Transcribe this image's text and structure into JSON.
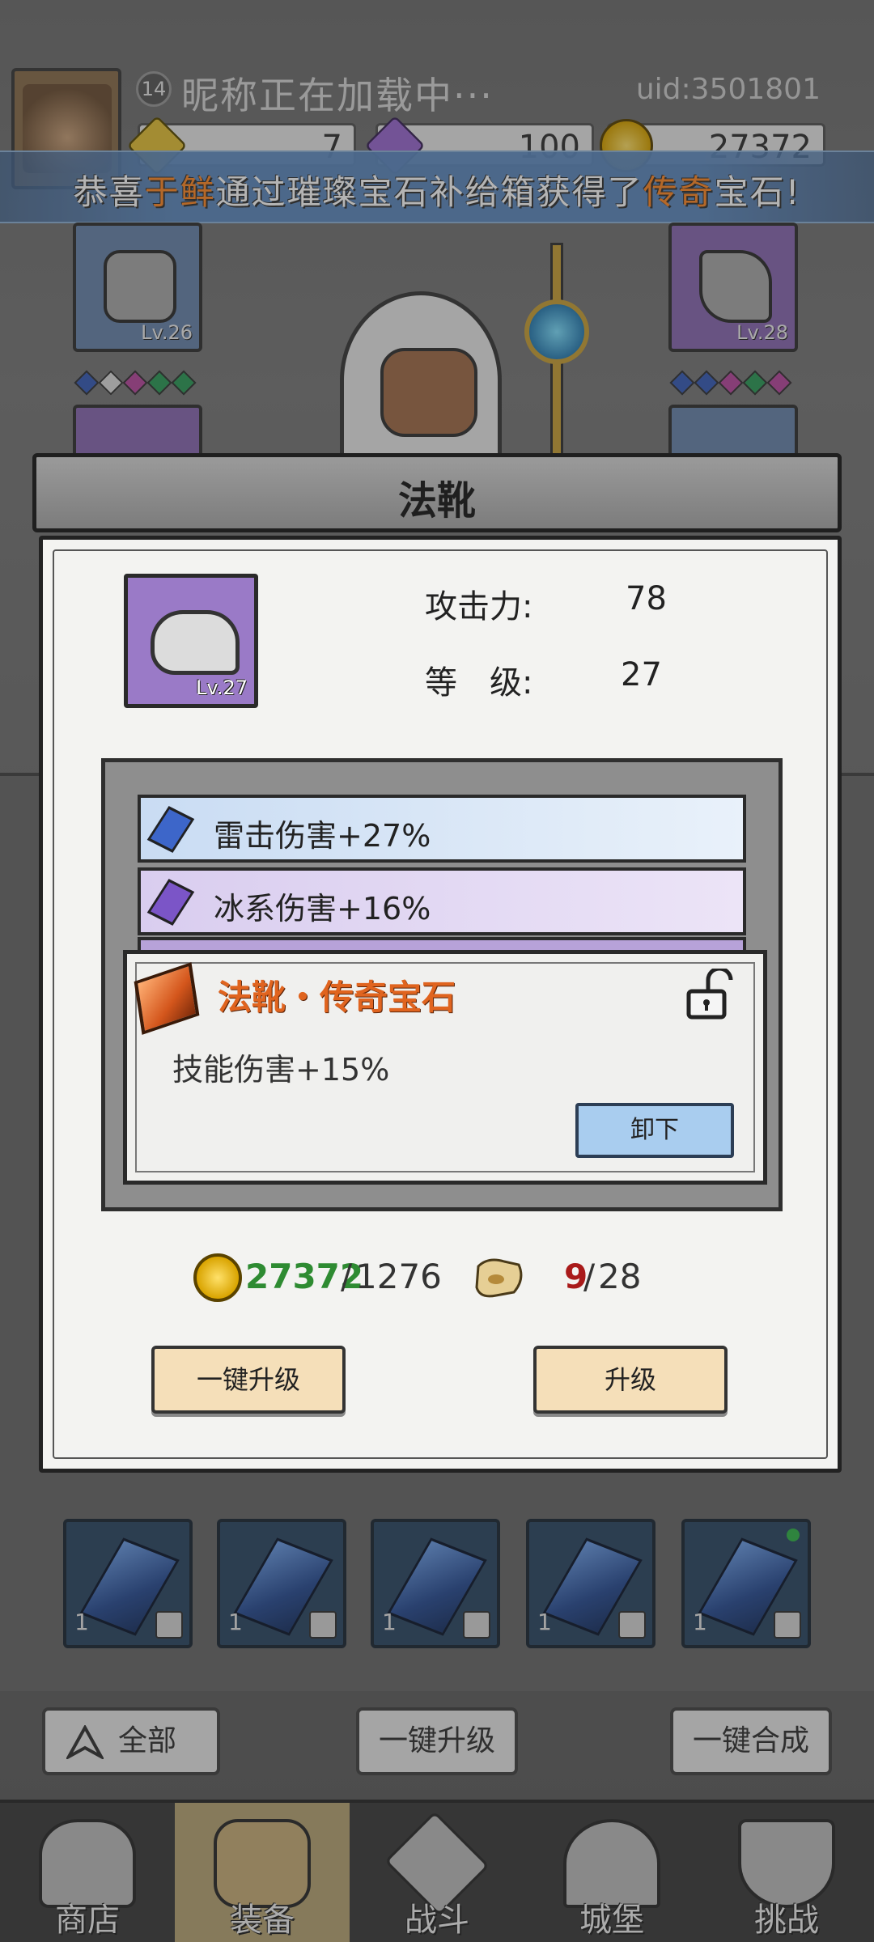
{
  "header": {
    "level": "14",
    "nickname": "昵称正在加载中···",
    "uid": "uid:3501801",
    "currencies": [
      {
        "name": "gold-gem-icon",
        "value": "7",
        "color": "#e5c23a"
      },
      {
        "name": "purple-diamond-icon",
        "value": "100",
        "color": "#9b6ad1"
      },
      {
        "name": "gold-coin-icon",
        "value": "27372",
        "color": "#d9a400"
      }
    ]
  },
  "announcement": {
    "prefix": "恭喜",
    "player": "于鲜",
    "middle": "通过璀璨宝石补给箱获得了",
    "item": "传奇",
    "suffix": "宝石!"
  },
  "equipment_slots": [
    {
      "name": "helmet",
      "level": "Lv.26"
    },
    {
      "name": "pipe",
      "level": "Lv.28"
    }
  ],
  "modal": {
    "title": "法靴",
    "item_level": "Lv.27",
    "stats": [
      {
        "label": "攻击力:",
        "value": "78"
      },
      {
        "label": "等　级:",
        "value": "27"
      }
    ],
    "gems": [
      {
        "text": "雷击伤害+27%",
        "color": "#3d66c9",
        "bg": "#dbe9f7"
      },
      {
        "text": "冰系伤害+16%",
        "color": "#7b55c7",
        "bg": "#e6dcf5"
      }
    ],
    "legend_gem": {
      "title": "法靴・传奇宝石",
      "desc": "技能伤害+15%",
      "unequip_label": "卸下"
    },
    "cost": {
      "coin_have": "27372",
      "coin_need": "1276",
      "scroll_have": "9",
      "scroll_need": "28"
    },
    "buttons": {
      "one_click_upgrade": "一键升级",
      "upgrade": "升级"
    }
  },
  "inventory": {
    "count": "1",
    "buttons": {
      "all": "全部",
      "one_click_upgrade": "一键升级",
      "one_click_merge": "一键合成"
    }
  },
  "nav": [
    {
      "label": "商店"
    },
    {
      "label": "装备"
    },
    {
      "label": "战斗"
    },
    {
      "label": "城堡"
    },
    {
      "label": "挑战"
    }
  ]
}
